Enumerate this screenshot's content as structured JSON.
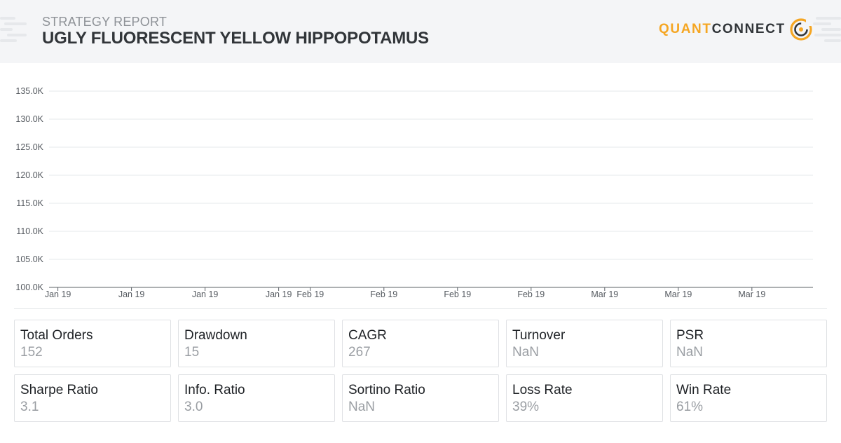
{
  "header": {
    "label": "STRATEGY REPORT",
    "title": "UGLY FLUORESCENT YELLOW HIPPOPOTAMUS",
    "logo": {
      "part1": "QUANT",
      "part2": "CONNECT",
      "icon": "quantconnect-logo-icon"
    }
  },
  "colors": {
    "header_bg": "#f4f5f7",
    "title": "#313539",
    "brand_orange": "#f5a623",
    "grid": "#e6e8eb",
    "axis": "#555a60"
  },
  "chart_data": {
    "type": "line",
    "title": "",
    "xlabel": "",
    "ylabel": "",
    "ylim": [
      100000,
      135000
    ],
    "yticks": [
      {
        "value": 100000,
        "label": "100.0K"
      },
      {
        "value": 105000,
        "label": "105.0K"
      },
      {
        "value": 110000,
        "label": "110.0K"
      },
      {
        "value": 115000,
        "label": "115.0K"
      },
      {
        "value": 120000,
        "label": "120.0K"
      },
      {
        "value": 125000,
        "label": "125.0K"
      },
      {
        "value": 130000,
        "label": "130.0K"
      },
      {
        "value": 135000,
        "label": "135.0K"
      }
    ],
    "xticks": [
      {
        "value": 0,
        "label": "Jan 19"
      },
      {
        "value": 1,
        "label": "Jan 19"
      },
      {
        "value": 2,
        "label": "Jan 19"
      },
      {
        "value": 3,
        "label": "Jan 19"
      },
      {
        "value": 3.43,
        "label": "Feb 19"
      },
      {
        "value": 4.43,
        "label": "Feb 19"
      },
      {
        "value": 5.43,
        "label": "Feb 19"
      },
      {
        "value": 6.43,
        "label": "Feb 19"
      },
      {
        "value": 7.43,
        "label": "Mar 19"
      },
      {
        "value": 8.43,
        "label": "Mar 19"
      },
      {
        "value": 9.43,
        "label": "Mar 19"
      }
    ],
    "xlim": [
      -0.12,
      10.26
    ],
    "grid": true,
    "series": []
  },
  "stats": [
    {
      "label": "Total Orders",
      "value": "152"
    },
    {
      "label": "Drawdown",
      "value": "15"
    },
    {
      "label": "CAGR",
      "value": "267"
    },
    {
      "label": "Turnover",
      "value": "NaN"
    },
    {
      "label": "PSR",
      "value": "NaN"
    },
    {
      "label": "Sharpe Ratio",
      "value": "3.1"
    },
    {
      "label": "Info. Ratio",
      "value": "3.0"
    },
    {
      "label": "Sortino Ratio",
      "value": "NaN"
    },
    {
      "label": "Loss Rate",
      "value": "39%"
    },
    {
      "label": "Win Rate",
      "value": "61%"
    }
  ]
}
